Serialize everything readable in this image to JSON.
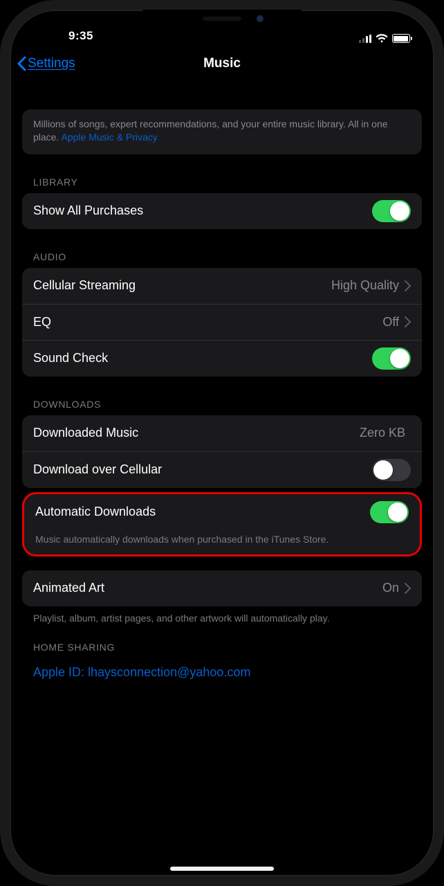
{
  "status": {
    "time": "9:35"
  },
  "nav": {
    "back": "Settings",
    "title": "Music"
  },
  "intro": {
    "text": "Millions of songs, expert recommendations, and your entire music library. All in one place. ",
    "link": "Apple Music & Privacy"
  },
  "sections": {
    "library": {
      "header": "LIBRARY",
      "show_all_purchases": "Show All Purchases"
    },
    "audio": {
      "header": "AUDIO",
      "cellular_streaming": {
        "label": "Cellular Streaming",
        "value": "High Quality"
      },
      "eq": {
        "label": "EQ",
        "value": "Off"
      },
      "sound_check": "Sound Check"
    },
    "downloads": {
      "header": "DOWNLOADS",
      "downloaded_music": {
        "label": "Downloaded Music",
        "value": "Zero KB"
      },
      "download_over_cellular": "Download over Cellular",
      "automatic_downloads": "Automatic Downloads",
      "auto_footer": "Music automatically downloads when purchased in the iTunes Store."
    },
    "animated": {
      "label": "Animated Art",
      "value": "On",
      "footer": "Playlist, album, artist pages, and other artwork will automatically play."
    },
    "home_sharing": {
      "header": "HOME SHARING",
      "apple_id": "Apple ID: lhaysconnection@yahoo.com"
    }
  },
  "toggles": {
    "show_all_purchases": true,
    "sound_check": true,
    "download_over_cellular": false,
    "automatic_downloads": true
  }
}
